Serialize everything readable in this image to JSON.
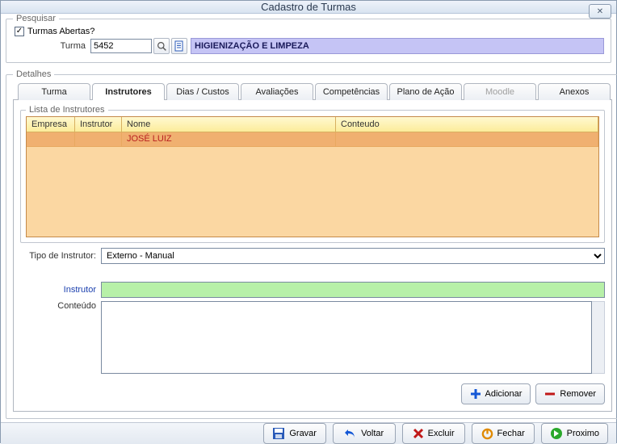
{
  "window": {
    "title": "Cadastro de Turmas",
    "close_glyph": "✕"
  },
  "pesquisar": {
    "legend": "Pesquisar",
    "checkbox_label": "Turmas Abertas?",
    "checkbox_checked": "✓",
    "turma_label": "Turma",
    "turma_value": "5452",
    "course_name": "HIGIENIZAÇÃO E LIMPEZA"
  },
  "detalhes": {
    "legend": "Detalhes",
    "tabs": {
      "turma": "Turma",
      "instrutores": "Instrutores",
      "dias_custos": "Dias / Custos",
      "avaliacoes": "Avaliações",
      "competencias": "Competências",
      "plano_acao": "Plano de Ação",
      "moodle": "Moodle",
      "anexos": "Anexos"
    }
  },
  "lista": {
    "legend": "Lista de Instrutores",
    "columns": {
      "empresa": "Empresa",
      "instrutor": "Instrutor",
      "nome": "Nome",
      "conteudo": "Conteudo"
    },
    "rows": [
      {
        "empresa": "",
        "instrutor": "",
        "nome": "JOSÉ LUIZ",
        "conteudo": ""
      }
    ]
  },
  "form": {
    "tipo_label": "Tipo de Instrutor:",
    "tipo_value": "Externo - Manual",
    "instrutor_label": "Instrutor",
    "instrutor_value": "",
    "conteudo_label": "Conteúdo",
    "conteudo_value": ""
  },
  "buttons": {
    "adicionar": "Adicionar",
    "remover": "Remover",
    "gravar": "Gravar",
    "voltar": "Voltar",
    "excluir": "Excluir",
    "fechar": "Fechar",
    "proximo": "Proximo"
  }
}
